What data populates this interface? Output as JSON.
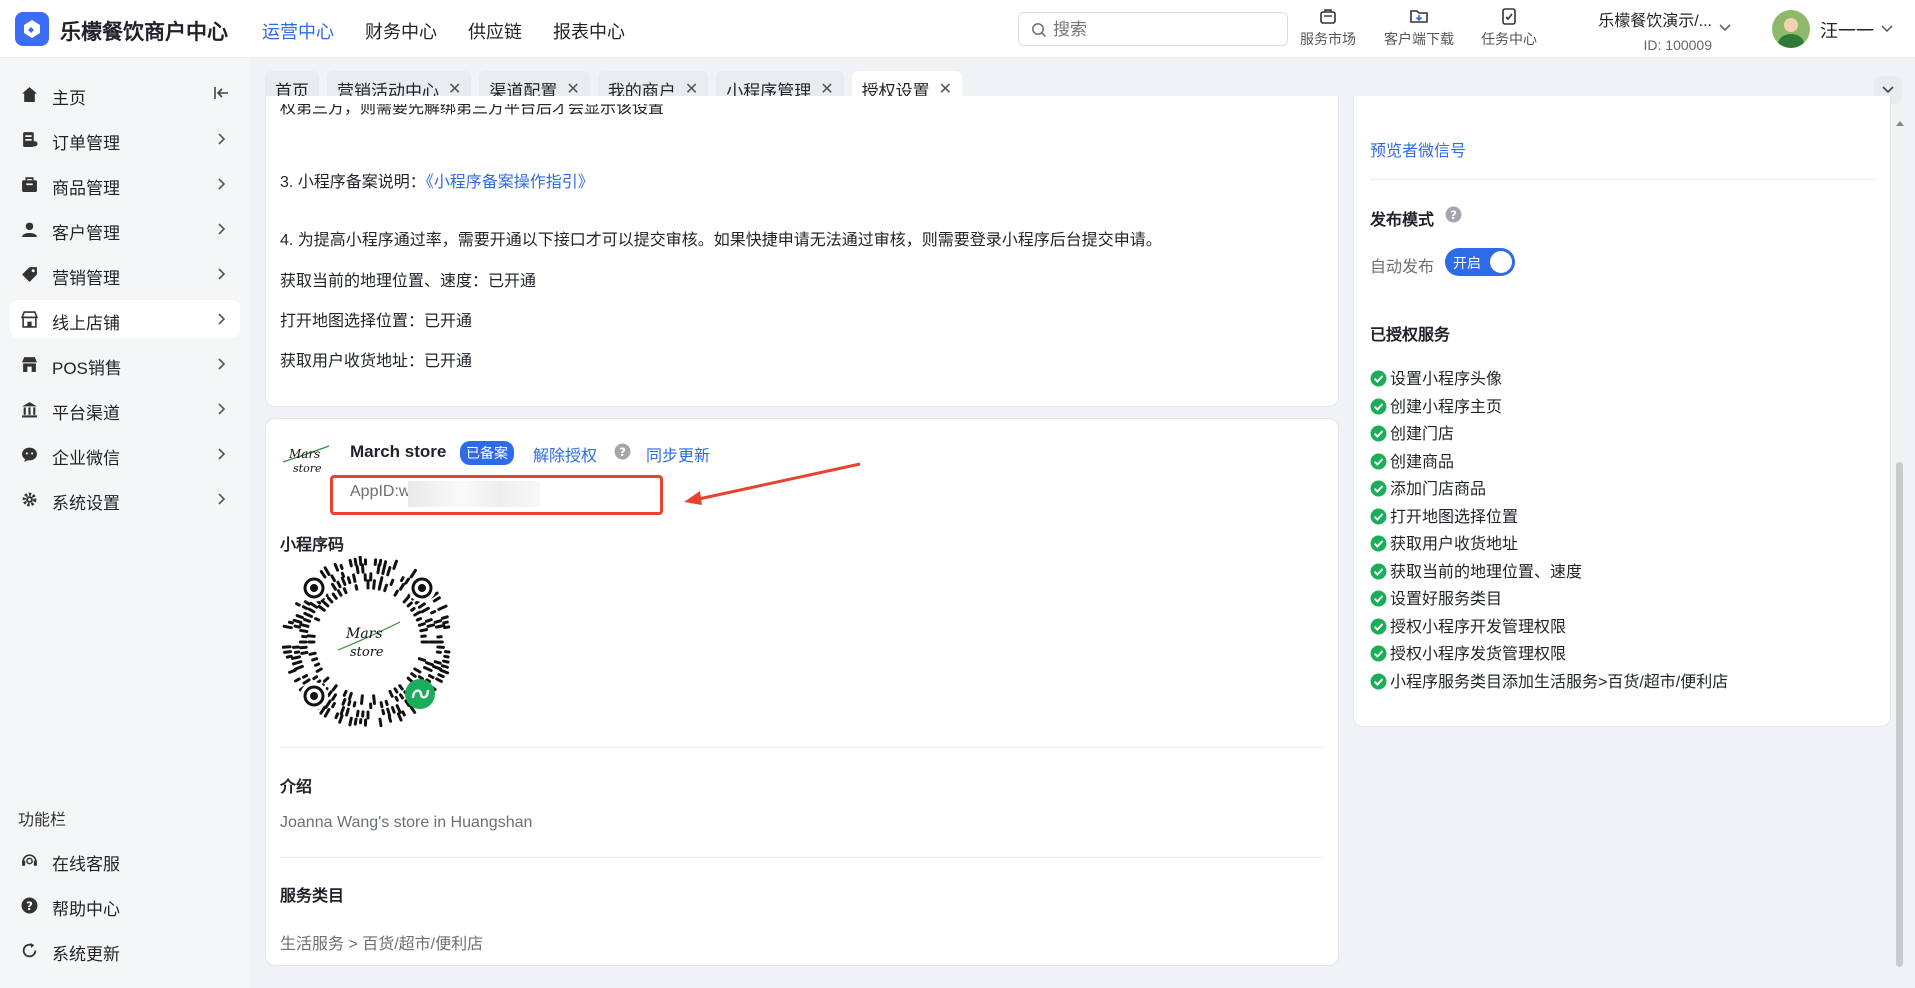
{
  "app": {
    "title": "乐檬餐饮商户中心"
  },
  "top_nav": {
    "items": [
      "运营中心",
      "财务中心",
      "供应链",
      "报表中心"
    ],
    "active": 0
  },
  "search": {
    "placeholder": "搜索"
  },
  "tools": [
    {
      "icon": "service-market-icon",
      "label": "服务市场"
    },
    {
      "icon": "client-download-icon",
      "label": "客户端下载"
    },
    {
      "icon": "task-center-icon",
      "label": "任务中心"
    }
  ],
  "merchant": {
    "name": "乐檬餐饮演示/...",
    "id": "ID: 100009"
  },
  "user": {
    "name": "汪一一"
  },
  "sidebar": {
    "items": [
      {
        "label": "主页",
        "icon": "home-icon"
      },
      {
        "label": "订单管理",
        "icon": "order-icon"
      },
      {
        "label": "商品管理",
        "icon": "goods-icon"
      },
      {
        "label": "客户管理",
        "icon": "customer-icon"
      },
      {
        "label": "营销管理",
        "icon": "tag-icon"
      },
      {
        "label": "线上店铺",
        "icon": "store-icon"
      },
      {
        "label": "POS销售",
        "icon": "pos-icon"
      },
      {
        "label": "平台渠道",
        "icon": "bank-icon"
      },
      {
        "label": "企业微信",
        "icon": "wechat-work-icon"
      },
      {
        "label": "系统设置",
        "icon": "gear-icon"
      }
    ],
    "active": 5,
    "section_label": "功能栏",
    "tools": [
      {
        "label": "在线客服",
        "icon": "headset-icon"
      },
      {
        "label": "帮助中心",
        "icon": "help-icon"
      },
      {
        "label": "系统更新",
        "icon": "refresh-icon"
      }
    ]
  },
  "tabs": [
    {
      "label": "首页",
      "closable": false
    },
    {
      "label": "营销活动中心",
      "closable": true
    },
    {
      "label": "渠道配置",
      "closable": true
    },
    {
      "label": "我的商户",
      "closable": true
    },
    {
      "label": "小程序管理",
      "closable": true
    },
    {
      "label": "授权设置",
      "closable": true
    }
  ],
  "notes": {
    "cut_line": "权第三方，则需要先解绑第三方平台后才会显示该设置",
    "item3_prefix": "3. 小程序备案说明：",
    "item3_link": "《小程序备案操作指引》",
    "item4": "4. 为提高小程序通过率，需要开通以下接口才可以提交审核。如果快捷申请无法通过审核，则需要登录小程序后台提交申请。",
    "status_lines": [
      "获取当前的地理位置、速度：已开通",
      "打开地图选择位置：已开通",
      "获取用户收货地址：已开通"
    ]
  },
  "store": {
    "name": "March store",
    "badge": "已备案",
    "unauthorize": "解除授权",
    "sync": "同步更新",
    "appid": "AppID:wx",
    "logo_text_1": "Mars",
    "logo_text_2": "store",
    "qr_title": "小程序码",
    "intro_title": "介绍",
    "intro": "Joanna Wang's store in Huangshan",
    "category_title": "服务类目",
    "category": "生活服务 > 百货/超市/便利店"
  },
  "right_panel": {
    "preview_link": "预览者微信号",
    "publish_title": "发布模式",
    "auto_publish_label": "自动发布",
    "toggle_text": "开启",
    "toggle_on": true,
    "authorized_title": "已授权服务",
    "authorized": [
      "设置小程序头像",
      "创建小程序主页",
      "创建门店",
      "创建商品",
      "添加门店商品",
      "打开地图选择位置",
      "获取用户收货地址",
      "获取当前的地理位置、速度",
      "设置好服务类目",
      "授权小程序开发管理权限",
      "授权小程序发货管理权限",
      "小程序服务类目添加生活服务>百货/超市/便利店"
    ]
  },
  "colors": {
    "accent": "#2e6be6",
    "annotation": "#e8432e",
    "success": "#1aad5a"
  }
}
